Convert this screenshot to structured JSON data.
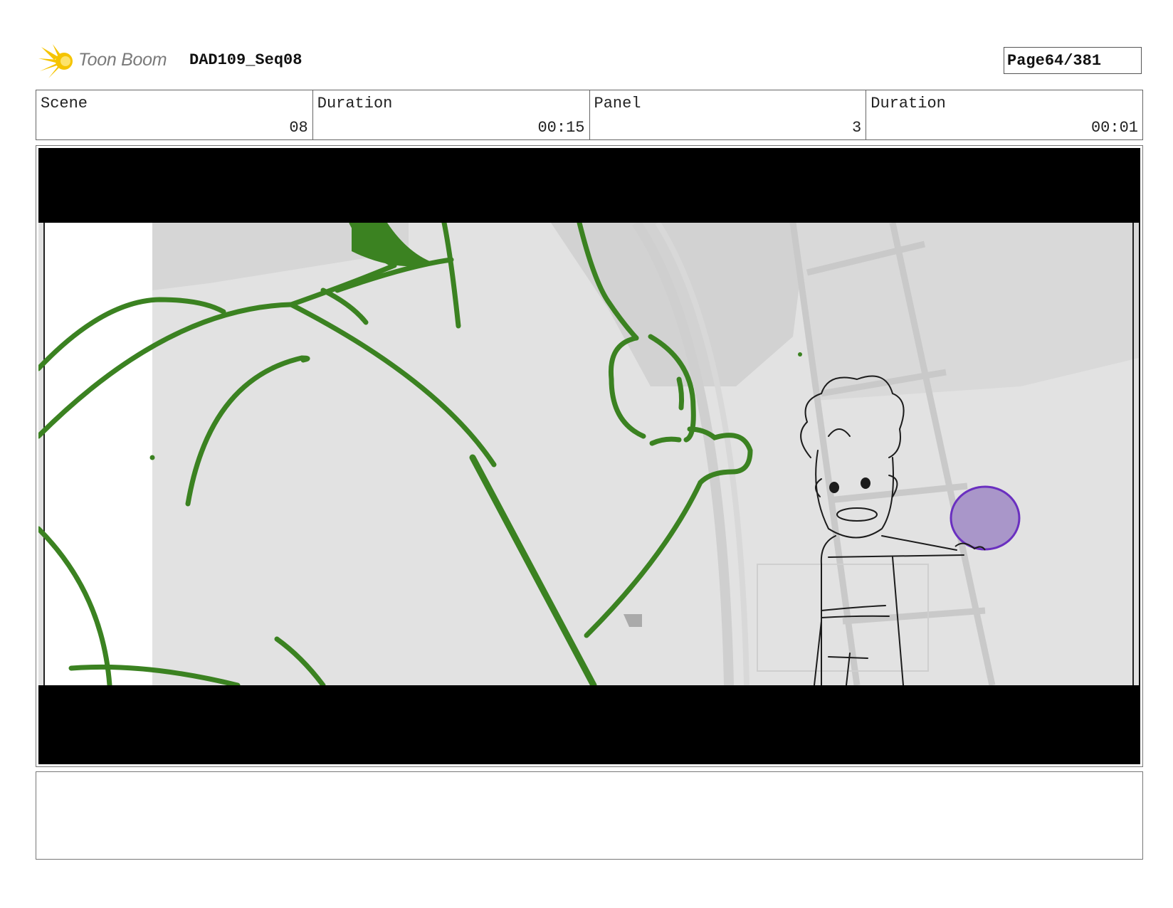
{
  "header": {
    "logo_text": "Toon Boom",
    "project_title": "DAD109_Seq08",
    "page_label": "Page",
    "page_number": "64/381"
  },
  "info": {
    "scene_label": "Scene",
    "scene_value": "08",
    "scene_duration_label": "Duration",
    "scene_duration_value": "00:15",
    "panel_label": "Panel",
    "panel_value": "3",
    "panel_duration_label": "Duration",
    "panel_duration_value": "00:01"
  },
  "colors": {
    "sketch_green": "#3b8221",
    "orb_purple": "#a996c9",
    "orb_outline": "#6a2fc0",
    "background_gray": "#e4e4e4"
  },
  "notes": ""
}
